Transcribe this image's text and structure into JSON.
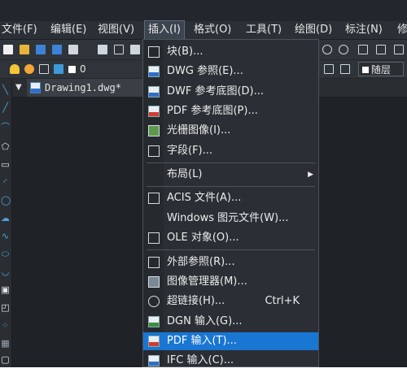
{
  "menubar": {
    "items": [
      {
        "label": "文件(F)"
      },
      {
        "label": "编辑(E)"
      },
      {
        "label": "视图(V)"
      },
      {
        "label": "插入(I)"
      },
      {
        "label": "格式(O)"
      },
      {
        "label": "工具(T)"
      },
      {
        "label": "绘图(D)"
      },
      {
        "label": "标注(N)"
      },
      {
        "label": "修"
      }
    ]
  },
  "layer": {
    "current": "0",
    "bylayer": "随层"
  },
  "document": {
    "tab_title": "Drawing1.dwg*"
  },
  "insert_menu": {
    "items": [
      {
        "label": "块(B)...",
        "icon": "block-icon"
      },
      {
        "label": "DWG 参照(E)...",
        "icon": "dwg-reference-icon"
      },
      {
        "label": "DWF 参考底图(D)...",
        "icon": "dwf-underlay-icon"
      },
      {
        "label": "PDF 参考底图(P)...",
        "icon": "pdf-underlay-icon"
      },
      {
        "label": "光栅图像(I)...",
        "icon": "raster-image-icon"
      },
      {
        "label": "字段(F)...",
        "icon": "field-icon"
      },
      {
        "label": "布局(L)",
        "icon": "",
        "submenu": true
      },
      {
        "label": "ACIS 文件(A)...",
        "icon": "acis-icon"
      },
      {
        "label": "Windows 图元文件(W)...",
        "icon": ""
      },
      {
        "label": "OLE 对象(O)...",
        "icon": "ole-icon"
      },
      {
        "label": "外部参照(R)...",
        "icon": "xref-icon"
      },
      {
        "label": "图像管理器(M)...",
        "icon": "image-manager-icon"
      },
      {
        "label": "超链接(H)...",
        "icon": "hyperlink-icon",
        "shortcut": "Ctrl+K"
      },
      {
        "label": "DGN 输入(G)...",
        "icon": "dgn-import-icon"
      },
      {
        "label": "PDF 输入(T)...",
        "icon": "pdf-import-icon"
      },
      {
        "label": "IFC 输入(C)...",
        "icon": "ifc-import-icon"
      }
    ]
  },
  "colors": {
    "highlight": "#1976d2",
    "background": "#23272d",
    "menu_text": "#ececec"
  }
}
